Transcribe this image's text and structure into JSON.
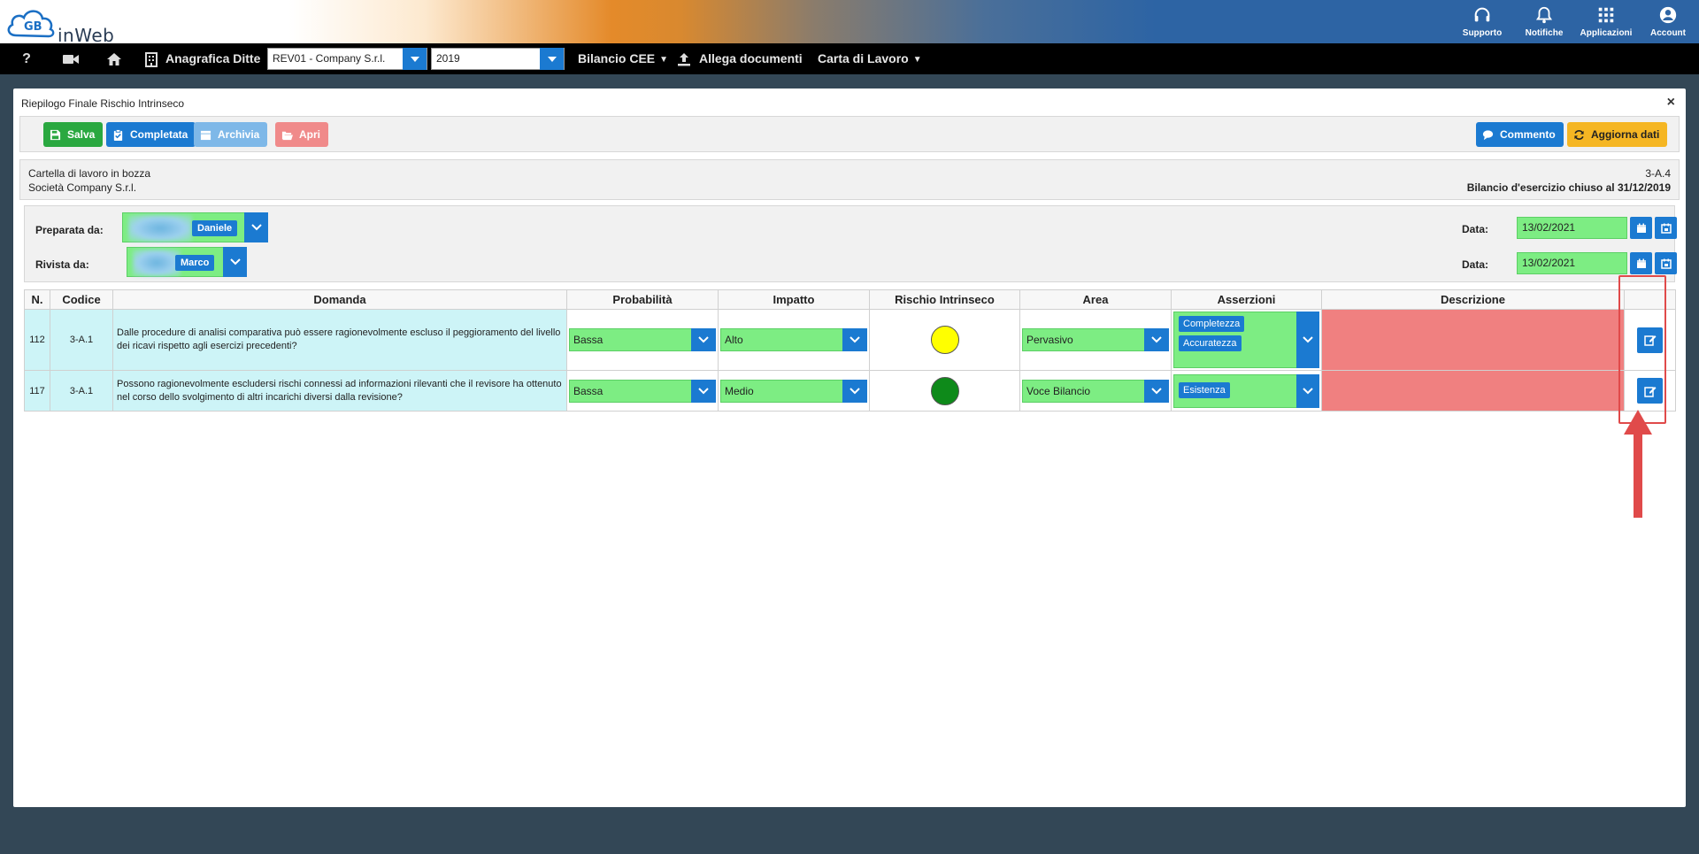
{
  "app": {
    "name": "inWeb",
    "logo_letters": "GB"
  },
  "top_actions": [
    {
      "label": "Supporto",
      "icon": "headset-icon"
    },
    {
      "label": "Notifiche",
      "icon": "bell-icon"
    },
    {
      "label": "Applicazioni",
      "icon": "grid-icon"
    },
    {
      "label": "Account",
      "icon": "account-icon"
    }
  ],
  "nav": {
    "help": "?",
    "anagrafica": "Anagrafica Ditte",
    "company_select": "REV01 - Company S.r.l.",
    "year_select": "2019",
    "bilancio": "Bilancio CEE",
    "allega": "Allega documenti",
    "carta": "Carta di Lavoro"
  },
  "modal": {
    "title": "Riepilogo Finale Rischio Intrinseco",
    "close": "×",
    "toolbar": {
      "salva": "Salva",
      "completata": "Completata",
      "archivia": "Archivia",
      "apri": "Apri",
      "commento": "Commento",
      "aggiorna": "Aggiorna dati"
    },
    "info": {
      "status": "Cartella di lavoro in bozza",
      "company": "Società Company S.r.l.",
      "code": "3-A.4",
      "period": "Bilancio d'esercizio chiuso al 31/12/2019"
    },
    "prep": {
      "preparata_label": "Preparata da:",
      "preparata_name": "Daniele",
      "rivista_label": "Rivista da:",
      "rivista_name": "Marco",
      "data_label": "Data:",
      "data_preparata": "13/02/2021",
      "data_rivista": "13/02/2021"
    },
    "table": {
      "headers": [
        "N.",
        "Codice",
        "Domanda",
        "Probabilità",
        "Impatto",
        "Rischio Intrinseco",
        "Area",
        "Asserzioni",
        "Descrizione",
        ""
      ],
      "rows": [
        {
          "n": "112",
          "codice": "3-A.1",
          "domanda": "Dalle procedure di analisi comparativa può essere ragionevolmente escluso il peggioramento del livello dei ricavi rispetto agli esercizi precedenti?",
          "probabilita": "Bassa",
          "impatto": "Alto",
          "rischio_color": "#ffff00",
          "area": "Pervasivo",
          "asserzioni": [
            "Completezza",
            "Accuratezza"
          ],
          "descrizione": ""
        },
        {
          "n": "117",
          "codice": "3-A.1",
          "domanda": "Possono ragionevolmente escludersi rischi connessi ad informazioni rilevanti che il revisore ha ottenuto nel corso dello svolgimento di altri incarichi diversi dalla revisione?",
          "probabilita": "Bassa",
          "impatto": "Medio",
          "rischio_color": "#0e8a1a",
          "area": "Voce Bilancio",
          "asserzioni": [
            "Esistenza"
          ],
          "descrizione": ""
        }
      ]
    }
  },
  "colors": {
    "accent": "#1b7ad1",
    "field_green": "#7ded83",
    "salva": "#2aa840",
    "archivia": "#7eb8e8",
    "apri": "#f08a8a",
    "aggiorna": "#f5b623",
    "highlight": "#e04a4a"
  }
}
